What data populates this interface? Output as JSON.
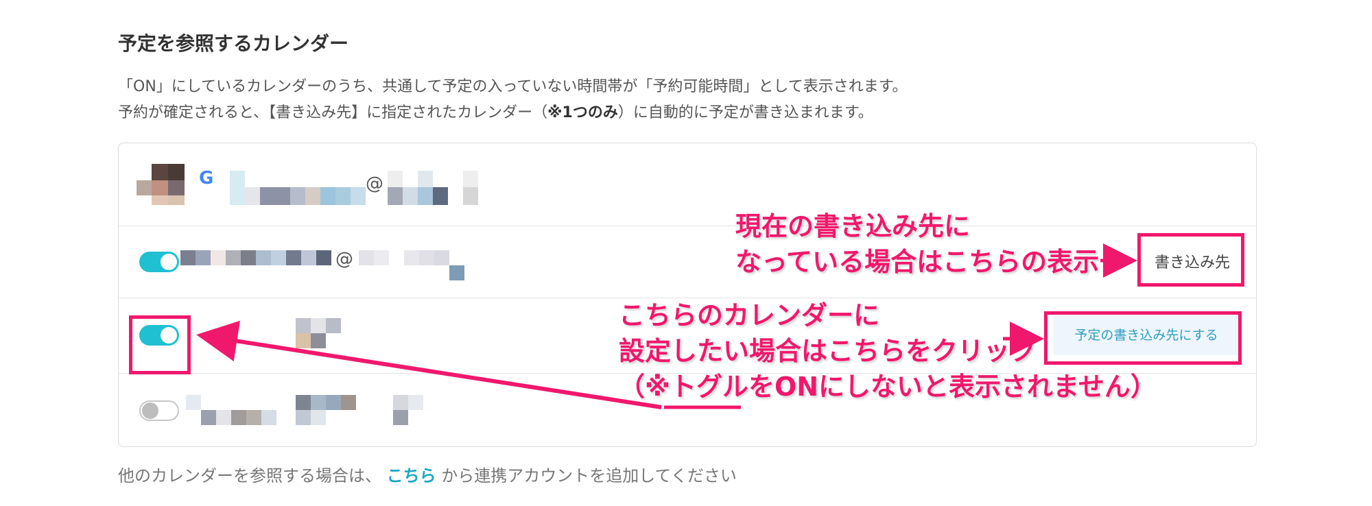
{
  "title": "予定を参照するカレンダー",
  "description": {
    "line1": "「ON」にしているカレンダーのうち、共通して予定の入っていない時間帯が「予約可能時間」として表示されます。",
    "line2_pre": "予約が確定されると、【書き込み先】に指定されたカレンダー（",
    "line2_bold": "※1つのみ",
    "line2_post": "）に自動的に予定が書き込まれます。"
  },
  "calendars": [
    {
      "account_icon": "google-icon",
      "at": "@"
    },
    {
      "toggle": "on",
      "at": "@",
      "write_label": "書き込み先"
    },
    {
      "toggle": "on",
      "button": "予定の書き込み先にする"
    },
    {
      "toggle": "off"
    }
  ],
  "annotations": {
    "current_line1": "現在の書き込み先に",
    "current_line2": "なっている場合はこちらの表示",
    "set_line1": "こちらのカレンダーに",
    "set_line2": "設定したい場合はこちらをクリック",
    "set_line3": "（※トグルをONにしないと表示されません）",
    "color": "#f0186c"
  },
  "footer": {
    "pre": "他のカレンダーを参照する場合は、",
    "link": "こちら",
    "post": "から連携アカウントを追加してください"
  },
  "colors": {
    "toggle_on": "#1ec0d2",
    "link": "#1aa8c4",
    "annotation": "#f0186c"
  }
}
